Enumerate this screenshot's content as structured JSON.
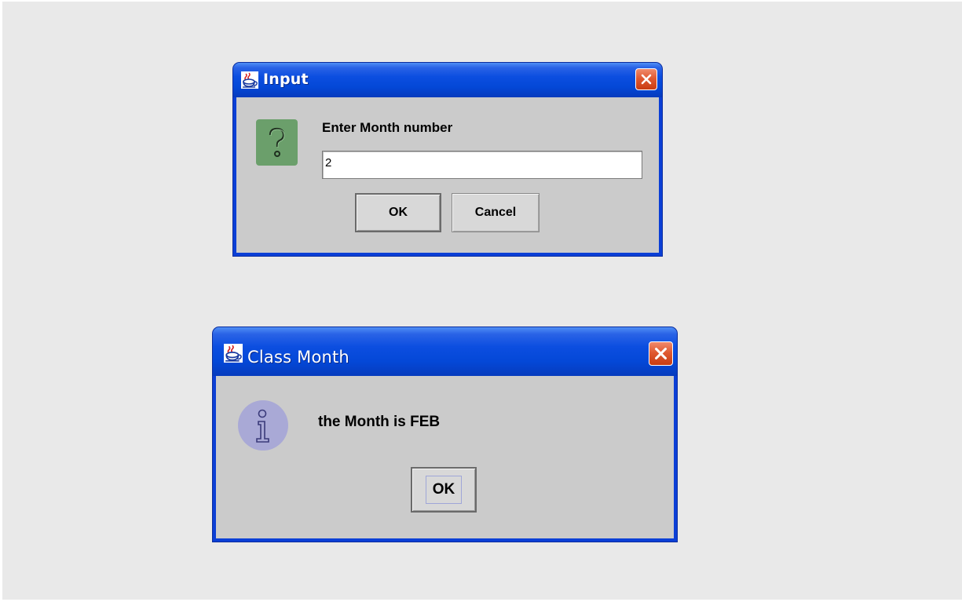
{
  "input_dialog": {
    "title": "Input",
    "prompt": "Enter Month number",
    "field_value": "2",
    "ok_label": "OK",
    "cancel_label": "Cancel",
    "icon": "question-icon"
  },
  "message_dialog": {
    "title": "Class Month",
    "message": "the Month is FEB",
    "ok_label": "OK",
    "icon": "information-icon"
  },
  "colors": {
    "titlebar": "#0448d7",
    "window_body": "#cbcbcb",
    "question_icon": "#6b9f6b",
    "info_icon": "#a9a9d6",
    "close_button": "#e05a32"
  }
}
